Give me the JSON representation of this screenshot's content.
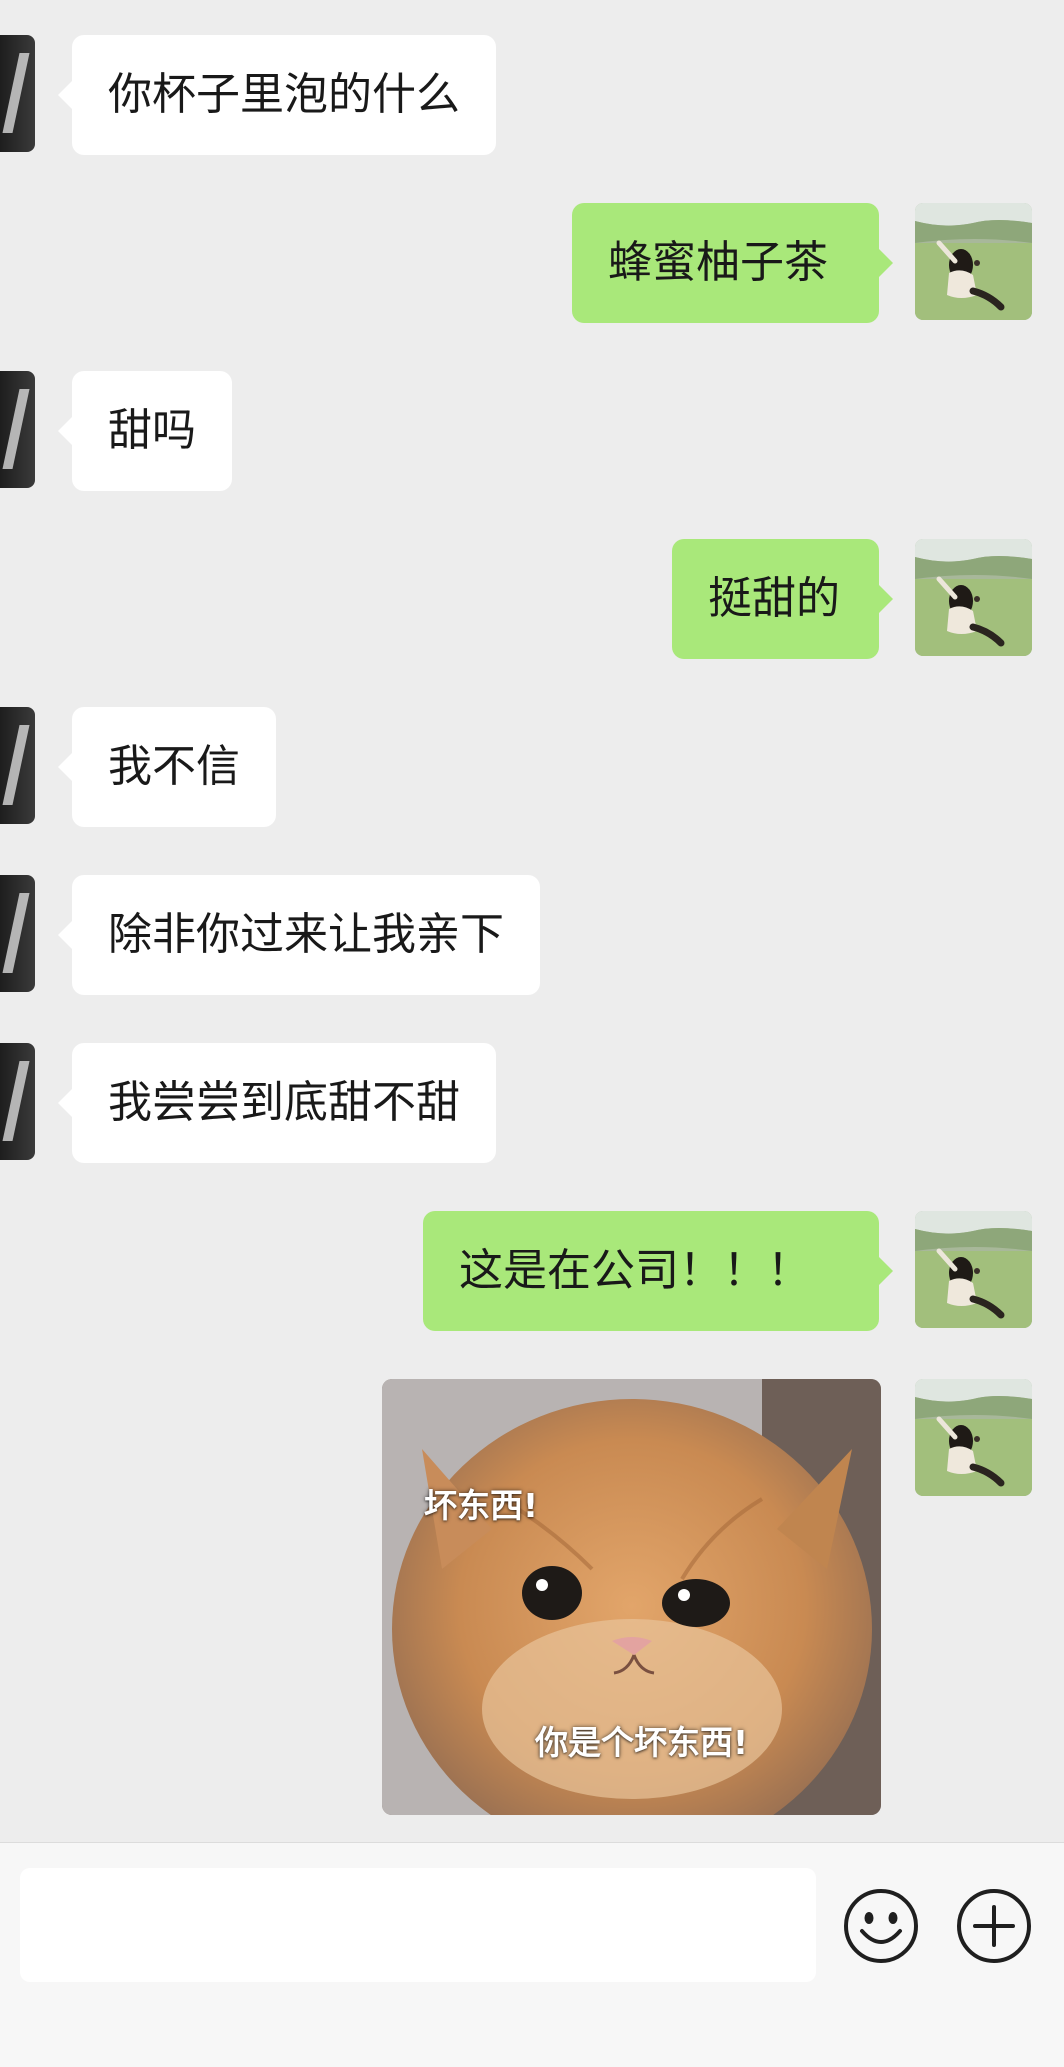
{
  "messages": [
    {
      "side": "in",
      "text": "你杯子里泡的什么"
    },
    {
      "side": "out",
      "text": "蜂蜜柚子茶"
    },
    {
      "side": "in",
      "text": "甜吗"
    },
    {
      "side": "out",
      "text": "挺甜的"
    },
    {
      "side": "in",
      "text": "我不信"
    },
    {
      "side": "in",
      "text": "除非你过来让我亲下"
    },
    {
      "side": "in",
      "text": "我尝尝到底甜不甜"
    },
    {
      "side": "out",
      "text": "这是在公司！！！"
    }
  ],
  "sticker": {
    "caption_top": "坏东西!",
    "caption_bottom": "你是个坏东西!"
  },
  "input_bar": {
    "placeholder": "",
    "emoji_icon": "emoji-icon",
    "add_icon": "plus-circle-icon"
  },
  "colors": {
    "background": "#ededed",
    "incoming_bubble": "#ffffff",
    "outgoing_bubble": "#a9e87a",
    "input_bar": "#f7f7f7"
  }
}
